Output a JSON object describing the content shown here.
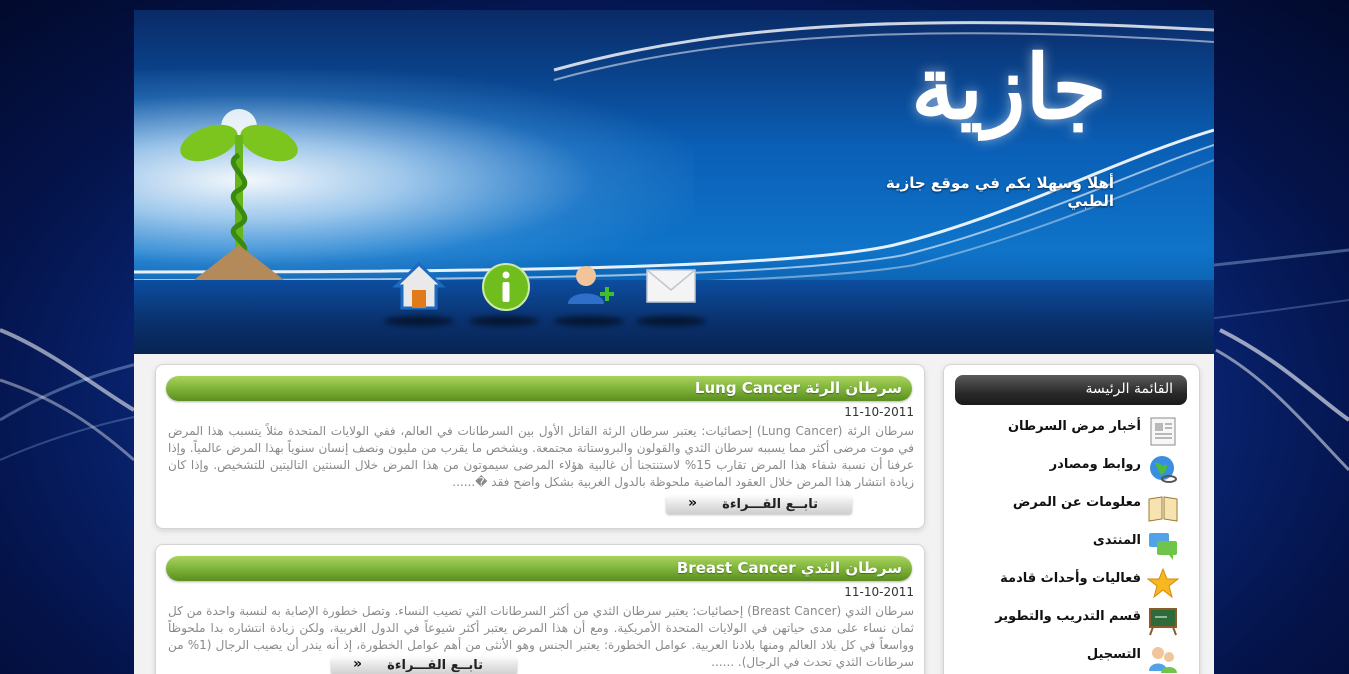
{
  "header": {
    "logo_text": "جازية",
    "welcome": "أهلا وسهلا بكم في موقع جازية الطبي",
    "nav": [
      {
        "icon": "home-icon"
      },
      {
        "icon": "info-icon"
      },
      {
        "icon": "add-user-icon"
      },
      {
        "icon": "mail-icon"
      }
    ]
  },
  "posts": [
    {
      "title": "سرطان الرئة Lung Cancer",
      "date": "11-10-2011",
      "body": "سرطان الرئة          (Lung Cancer)    إحصائيات:   يعتبر سرطان الرئة القاتل الأول بين السرطانات في العالم، ففي الولايات المتحدة مثلاً يتسبب هذا المرض في موت مرضى أكثر مما يسببه سرطان الثدي والقولون والبروستاتة مجتمعة. ويشخص ما يقرب من مليون ونصف إنسان سنوياً بهذا المرض عالمياً. وإذا عرفنا أن نسبة شفاء هذا المرض تقارب 15% لاستنتجنا أن غالبية هؤلاء المرضى سيموتون من هذا المرض خلال السنتين التاليتين للتشخيص. وإذا كان زيادة انتشار هذا المرض خلال العقود الماضية ملحوظة بالدول الغربية بشكل واضح فقد �......",
      "more": "تابــع القـــراءة"
    },
    {
      "title": "سرطان الثدي Breast Cancer",
      "date": "11-10-2011",
      "body": "سرطان الثدي (Breast Cancer)   إحصائيات:   يعتبر سرطان الثدي من أكثر السرطانات التي تصيب النساء. وتصل خطورة الإصابة به لنسبة واحدة من كل ثمان نساء على مدى حياتهن في الولايات المتحدة الأمريكية. ومع أن هذا المرض يعتبر أكثر شيوعاً في الدول الغربية، ولكن زيادة انتشاره بدا ملحوظاً وواسعاً في كل بلاد العالم ومنها بلادنا العربية.   عوامل الخطورة:     يعتبر الجنس وهو الأنثى من أهم عوامل الخطورة، إذ أنه يندر أن يصيب الرجال (1% من سرطانات الثدي تحدث في الرجال). ......",
      "more": "تابــع القـــراءة"
    }
  ],
  "sidebar": {
    "title": "القائمة الرئيسة",
    "items": [
      {
        "label": "أخبار مرض السرطان",
        "icon": "newspaper-icon"
      },
      {
        "label": "روابط ومصادر",
        "icon": "globe-link-icon"
      },
      {
        "label": "معلومات عن المرض",
        "icon": "open-book-icon"
      },
      {
        "label": "المنتدى",
        "icon": "chat-bubbles-icon"
      },
      {
        "label": "فعاليات وأحداث قادمة",
        "icon": "star-icon"
      },
      {
        "label": "قسم التدريب والتطوير",
        "icon": "chalkboard-icon"
      },
      {
        "label": "التسجيل",
        "icon": "users-icon"
      }
    ]
  },
  "colors": {
    "accent_green": "#7fb43a",
    "header_blue": "#0f74c9",
    "background_blue": "#0b2f8a"
  }
}
